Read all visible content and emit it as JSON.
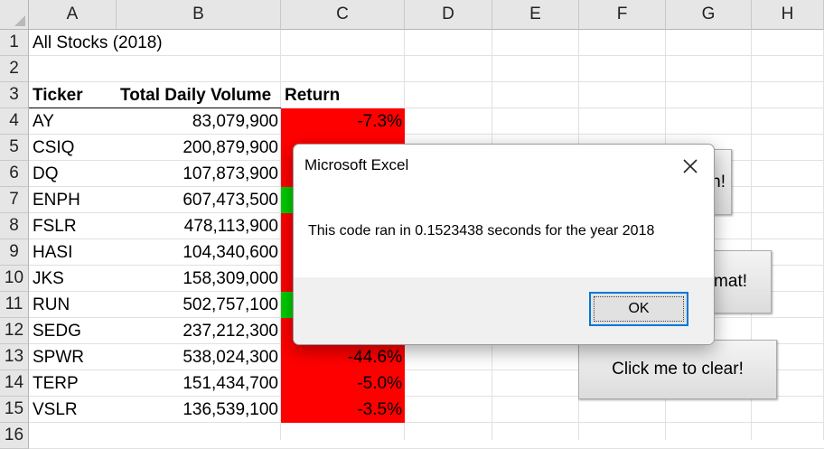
{
  "sheet": {
    "columns": [
      "A",
      "B",
      "C",
      "D",
      "E",
      "F",
      "G",
      "H"
    ],
    "rows": [
      "1",
      "2",
      "3",
      "4",
      "5",
      "6",
      "7",
      "8",
      "9",
      "10",
      "11",
      "12",
      "13",
      "14",
      "15",
      "16"
    ],
    "title": "All Stocks (2018)",
    "headers": {
      "ticker": "Ticker",
      "volume": "Total Daily Volume",
      "return": "Return"
    },
    "data": [
      {
        "ticker": "AY",
        "volume": "83,079,900",
        "return": "-7.3%",
        "fill": "red"
      },
      {
        "ticker": "CSIQ",
        "volume": "200,879,900",
        "return": "",
        "fill": "red"
      },
      {
        "ticker": "DQ",
        "volume": "107,873,900",
        "return": "",
        "fill": "red"
      },
      {
        "ticker": "ENPH",
        "volume": "607,473,500",
        "return": "",
        "fill": "green"
      },
      {
        "ticker": "FSLR",
        "volume": "478,113,900",
        "return": "",
        "fill": "red"
      },
      {
        "ticker": "HASI",
        "volume": "104,340,600",
        "return": "",
        "fill": "red"
      },
      {
        "ticker": "JKS",
        "volume": "158,309,000",
        "return": "",
        "fill": "red"
      },
      {
        "ticker": "RUN",
        "volume": "502,757,100",
        "return": "",
        "fill": "green"
      },
      {
        "ticker": "SEDG",
        "volume": "237,212,300",
        "return": "",
        "fill": "red"
      },
      {
        "ticker": "SPWR",
        "volume": "538,024,300",
        "return": "-44.6%",
        "fill": "red"
      },
      {
        "ticker": "TERP",
        "volume": "151,434,700",
        "return": "-5.0%",
        "fill": "red"
      },
      {
        "ticker": "VSLR",
        "volume": "136,539,100",
        "return": "-3.5%",
        "fill": "red"
      }
    ],
    "colors": {
      "red": "#ff0000",
      "green": "#00cc00"
    }
  },
  "buttons": {
    "run_partial": "n!",
    "format_partial": "mat!",
    "clear": "Click me to clear!"
  },
  "dialog": {
    "title": "Microsoft Excel",
    "message": "This code ran in 0.1523438 seconds for the year 2018",
    "ok_label": "OK",
    "close_icon": "close-icon"
  }
}
